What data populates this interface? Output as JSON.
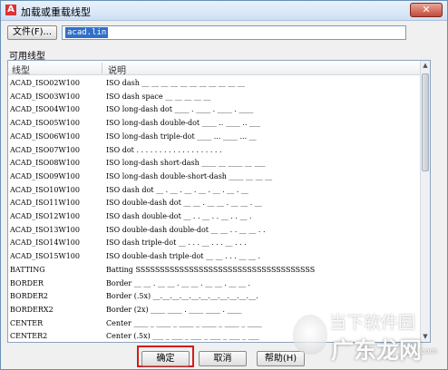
{
  "window": {
    "title": "加载或重载线型",
    "close_glyph": "✕",
    "app_icon_glyph": "A"
  },
  "file": {
    "button_label": "文件(F)...",
    "path": "acad.lin"
  },
  "available_label": "可用线型",
  "columns": {
    "linetype": "线型",
    "description": "说明"
  },
  "linetypes": [
    {
      "name": "ACAD_ISO02W100",
      "desc": "ISO dash __ __ __ __ __ __ __ __ __ __ __"
    },
    {
      "name": "ACAD_ISO03W100",
      "desc": "ISO dash space __    __    __    __    __"
    },
    {
      "name": "ACAD_ISO04W100",
      "desc": "ISO long-dash dot ____ . ____ . ____ . ____"
    },
    {
      "name": "ACAD_ISO05W100",
      "desc": "ISO long-dash double-dot ____ .. ____ .. ___"
    },
    {
      "name": "ACAD_ISO06W100",
      "desc": "ISO long-dash triple-dot ____ ... ____ ... __"
    },
    {
      "name": "ACAD_ISO07W100",
      "desc": "ISO dot . . . . . . . . . . . . . . . . . . ."
    },
    {
      "name": "ACAD_ISO08W100",
      "desc": "ISO long-dash short-dash ____ __ ____ __ ___"
    },
    {
      "name": "ACAD_ISO09W100",
      "desc": "ISO long-dash double-short-dash ____ __ __ __"
    },
    {
      "name": "ACAD_ISO10W100",
      "desc": "ISO dash dot __ . __ . __ . __ . __ . __ . __"
    },
    {
      "name": "ACAD_ISO11W100",
      "desc": "ISO double-dash dot __ __ . __ __ . __ __ . __"
    },
    {
      "name": "ACAD_ISO12W100",
      "desc": "ISO dash double-dot __ . . __ . . __ . . __ ."
    },
    {
      "name": "ACAD_ISO13W100",
      "desc": "ISO double-dash double-dot __ __ . . __ __ . ."
    },
    {
      "name": "ACAD_ISO14W100",
      "desc": "ISO dash triple-dot __ . . . __ . . . __ . . ."
    },
    {
      "name": "ACAD_ISO15W100",
      "desc": "ISO double-dash triple-dot __ __ . . . __ __ ."
    },
    {
      "name": "BATTING",
      "desc": "Batting SSSSSSSSSSSSSSSSSSSSSSSSSSSSSSSSSSSSS"
    },
    {
      "name": "BORDER",
      "desc": "Border __ __ . __ __ . __ __ . __ __ . __ __ ."
    },
    {
      "name": "BORDER2",
      "desc": "Border (.5x) __.__.__.__.__.__.__.__.__.__.__."
    },
    {
      "name": "BORDERX2",
      "desc": "Border (2x) ____ ____ . ____ ____ . ____"
    },
    {
      "name": "CENTER",
      "desc": "Center ____ _ ____ _ ____ _ ____ _ ____ _ ____"
    },
    {
      "name": "CENTER2",
      "desc": "Center (.5x) ___ _ ___ _ ___ _ ___ _ ___ _ ___"
    }
  ],
  "buttons": {
    "ok": "确定",
    "cancel": "取消",
    "help": "帮助(H)"
  },
  "watermark": {
    "line1": "当下软件园",
    "line2": "广东龙网",
    "line3": "com"
  }
}
